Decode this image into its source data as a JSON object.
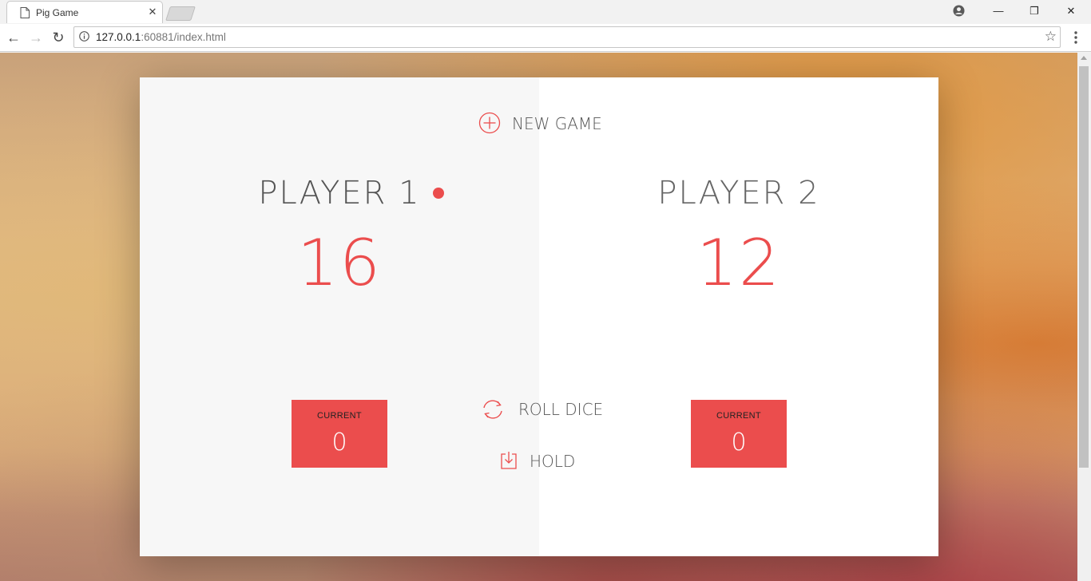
{
  "browser": {
    "tab_title": "Pig Game",
    "tab_close": "✕",
    "url_host": "127.0.0.1",
    "url_rest": ":60881/index.html",
    "window_controls": {
      "minimize": "—",
      "restore": "❐",
      "close": "✕"
    },
    "nav": {
      "back": "←",
      "forward": "→",
      "reload": "↻"
    },
    "star": "☆"
  },
  "game": {
    "new_game_label": "NEW GAME",
    "roll_dice_label": "ROLL DICE",
    "hold_label": "HOLD",
    "active_player": 1,
    "players": [
      {
        "name": "PLAYER 1",
        "score": "16",
        "current_label": "CURRENT",
        "current": "0"
      },
      {
        "name": "PLAYER 2",
        "score": "12",
        "current_label": "CURRENT",
        "current": "0"
      }
    ]
  },
  "colors": {
    "accent": "#eb4d4d",
    "active_panel": "#f7f7f7",
    "inactive_panel": "#ffffff"
  }
}
